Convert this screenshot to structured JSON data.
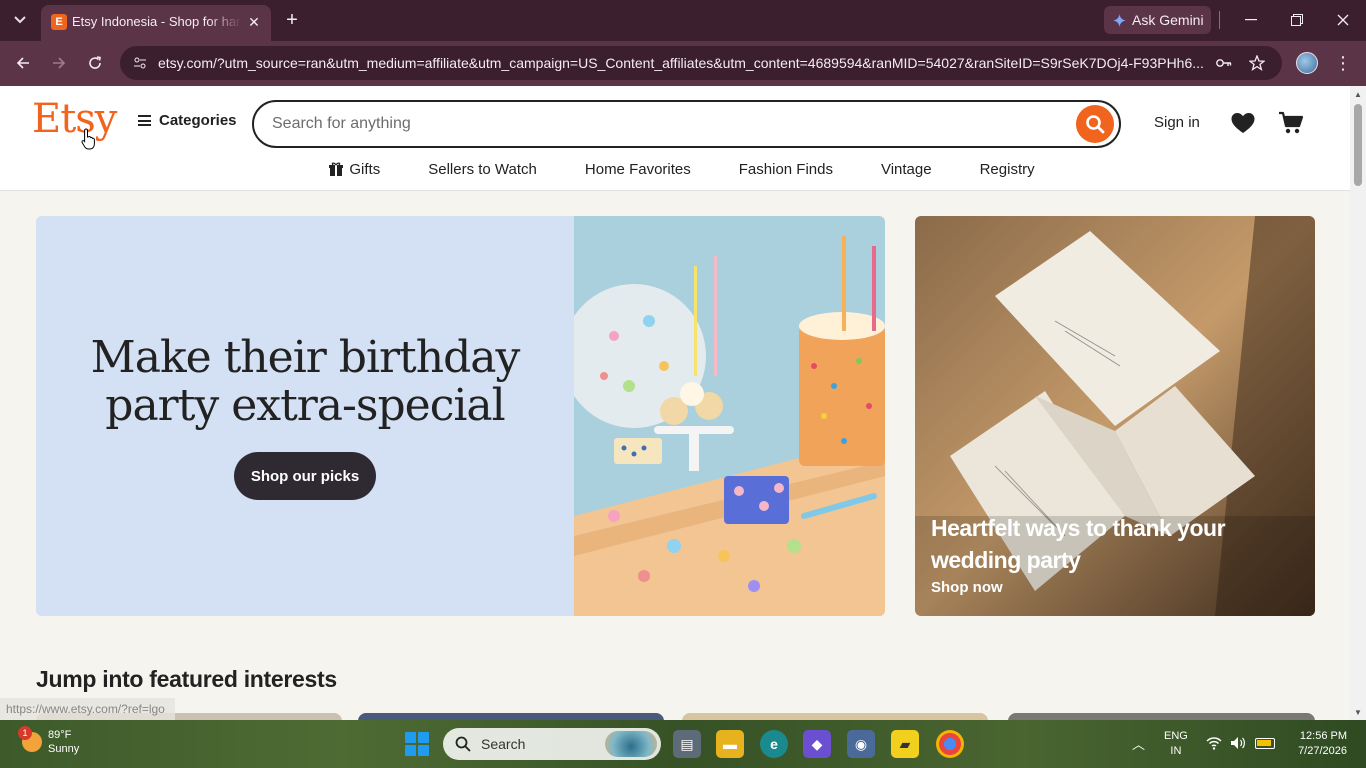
{
  "browser": {
    "tab_title": "Etsy Indonesia - Shop for handmade",
    "tab_favicon": "E",
    "gemini_label": "Ask Gemini",
    "url": "etsy.com/?utm_source=ran&utm_medium=affiliate&utm_campaign=US_Content_affiliates&utm_content=4689594&ranMID=54027&ranSiteID=S9rSeK7DOj4-F93PHh6..."
  },
  "header": {
    "logo": "Etsy",
    "categories_label": "Categories",
    "search_placeholder": "Search for anything",
    "signin_label": "Sign in"
  },
  "subnav": {
    "items": [
      "Gifts",
      "Sellers to Watch",
      "Home Favorites",
      "Fashion Finds",
      "Vintage",
      "Registry"
    ]
  },
  "hero": {
    "headline": "Make their birthday party extra-special",
    "cta": "Shop our picks"
  },
  "promo": {
    "title": "Heartfelt ways to thank your wedding party",
    "cta": "Shop now"
  },
  "featured": {
    "title": "Jump into featured interests"
  },
  "status_bar": {
    "link": "https://www.etsy.com/?ref=lgo"
  },
  "taskbar": {
    "weather_temp": "89°F",
    "weather_cond": "Sunny",
    "weather_badge": "1",
    "search_label": "Search",
    "lang_line1": "ENG",
    "lang_line2": "IN",
    "time": "12:56 PM",
    "date": "7/27/2026"
  },
  "colors": {
    "etsy_orange": "#f1641e",
    "hero_bg": "#d4e1f4",
    "browser_frame": "#3b1f2e"
  }
}
